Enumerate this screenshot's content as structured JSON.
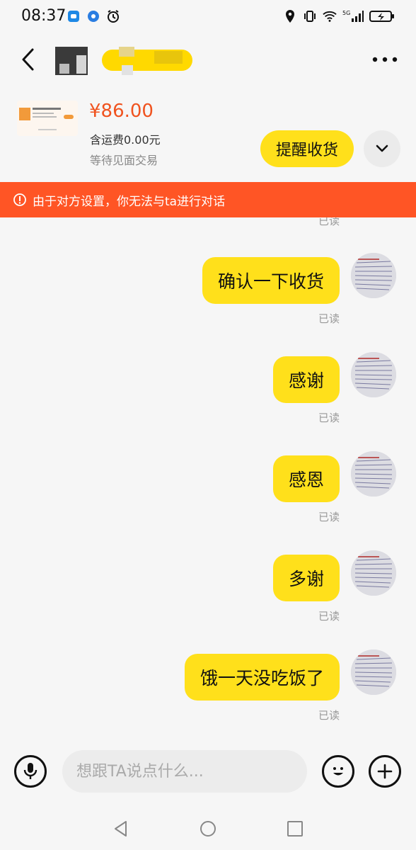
{
  "status_bar": {
    "time": "08:37",
    "network": "5G"
  },
  "header": {
    "back_icon": "chevron-left-icon",
    "more_icon": "more-horizontal-icon"
  },
  "product": {
    "price": "¥86.00",
    "shipping": "含运费0.00元",
    "status": "等待见面交易",
    "remind_label": "提醒收货",
    "expand_icon": "chevron-down-icon"
  },
  "banner": {
    "icon": "alert-circle-icon",
    "text": "由于对方设置，你无法与ta进行对话"
  },
  "chat": {
    "top_read": "已读",
    "messages": [
      {
        "text": "确认一下收货",
        "read": "已读"
      },
      {
        "text": "感谢",
        "read": "已读"
      },
      {
        "text": "感恩",
        "read": "已读"
      },
      {
        "text": "多谢",
        "read": "已读"
      },
      {
        "text": "饿一天没吃饭了",
        "read": "已读"
      }
    ]
  },
  "input": {
    "placeholder": "想跟TA说点什么..."
  },
  "colors": {
    "accent_yellow": "#ffe01b",
    "price_orange": "#f0531f",
    "banner_red": "#ff5525"
  }
}
